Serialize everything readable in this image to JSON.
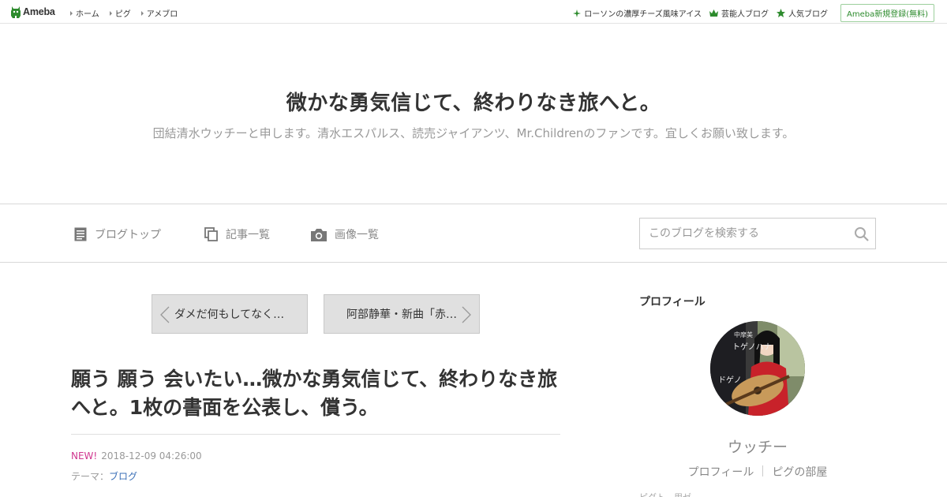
{
  "topbar": {
    "logo_text": "Ameba",
    "nav": [
      "ホーム",
      "ピグ",
      "アメブロ"
    ],
    "promo": "ローソンの濃厚チーズ風味アイス",
    "celeb_blog": "芸能人ブログ",
    "popular_blog": "人気ブログ",
    "register": "Ameba新規登録(無料)",
    "colors": {
      "brand_green": "#2d8b2d"
    }
  },
  "header": {
    "title": "微かな勇気信じて、終わりなき旅へと。",
    "description": "団結清水ウッチーと申します。清水エスパルス、読売ジャイアンツ、Mr.Childrenのファンです。宜しくお願い致します。"
  },
  "blognav": {
    "items": [
      "ブログトップ",
      "記事一覧",
      "画像一覧"
    ],
    "search_placeholder": "このブログを検索する"
  },
  "article": {
    "prev_label": "ダメだ何もしてなく…",
    "next_label": "阿部静華・新曲「赤…",
    "title": "願う 願う 会いたい…微かな勇気信じて、終わりなき旅へと。1枚の書面を公表し、償う。",
    "new_badge": "NEW!",
    "datetime": "2018-12-09 04:26:00",
    "theme_label": "テーマ：",
    "theme_value": "ブログ"
  },
  "sidebar": {
    "heading": "プロフィール",
    "nickname": "ウッチー",
    "links": [
      "プロフィール",
      "ピグの部屋"
    ],
    "cut_text": "ピグト　用ゼ"
  },
  "avatar_photo": {
    "overlay_text_1": "中摩美",
    "overlay_text_2": "トゲノハナ",
    "overlay_text_3": "ドゲノ"
  }
}
